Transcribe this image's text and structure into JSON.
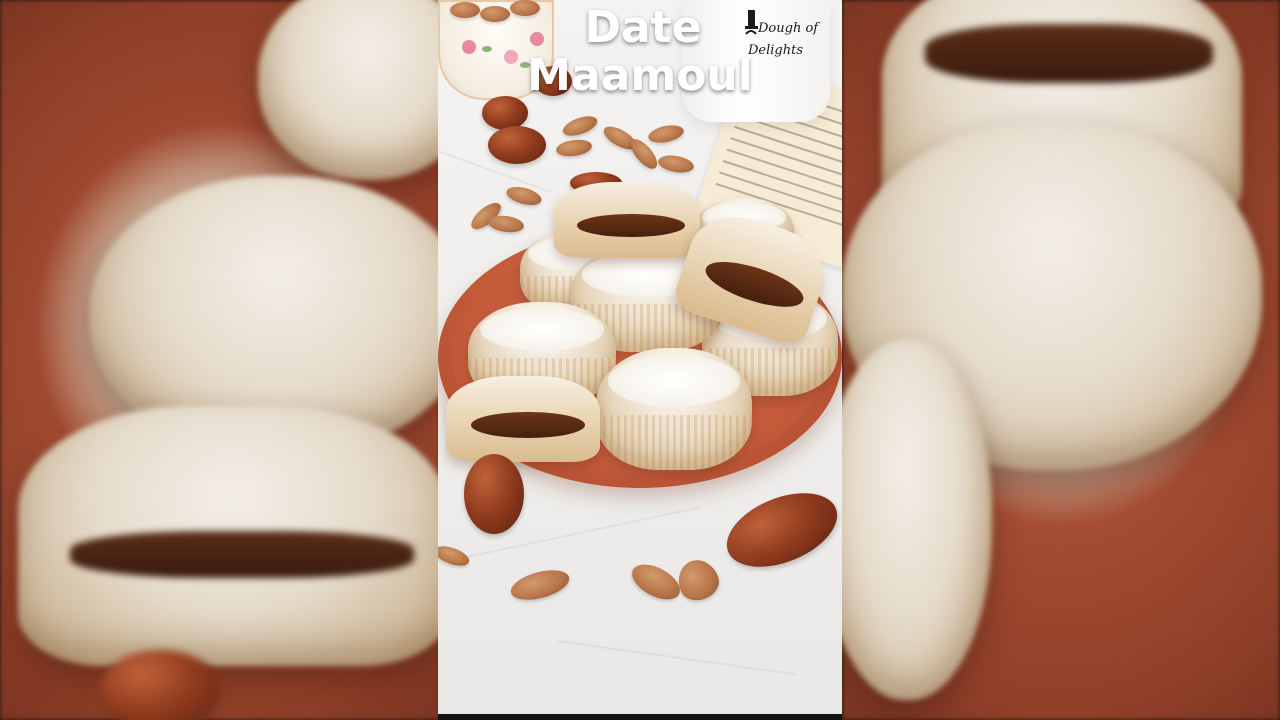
{
  "video": {
    "title_line1": "Date",
    "title_line2": "Maamoul",
    "logo_text": "Dough of Delights"
  },
  "colors": {
    "plate": "#c55d3c",
    "cookie": "#e2cfb0",
    "filling": "#47200d",
    "background": "#eeedeb",
    "title_text": "#ffffff"
  }
}
